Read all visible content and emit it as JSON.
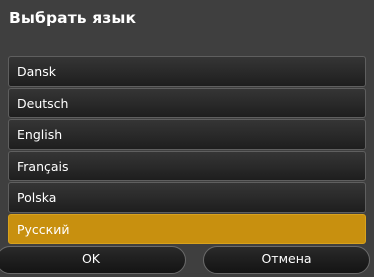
{
  "dialog": {
    "title": "Выбрать язык"
  },
  "languages": [
    {
      "label": "Dansk",
      "selected": false
    },
    {
      "label": "Deutsch",
      "selected": false
    },
    {
      "label": "English",
      "selected": false
    },
    {
      "label": "Français",
      "selected": false
    },
    {
      "label": "Polska",
      "selected": false
    },
    {
      "label": "Русский",
      "selected": true
    }
  ],
  "buttons": {
    "ok_label": "OK",
    "cancel_label": "Отмена"
  },
  "colors": {
    "background": "#3f3f3f",
    "selected": "#c8900f",
    "text": "#ffffff"
  }
}
